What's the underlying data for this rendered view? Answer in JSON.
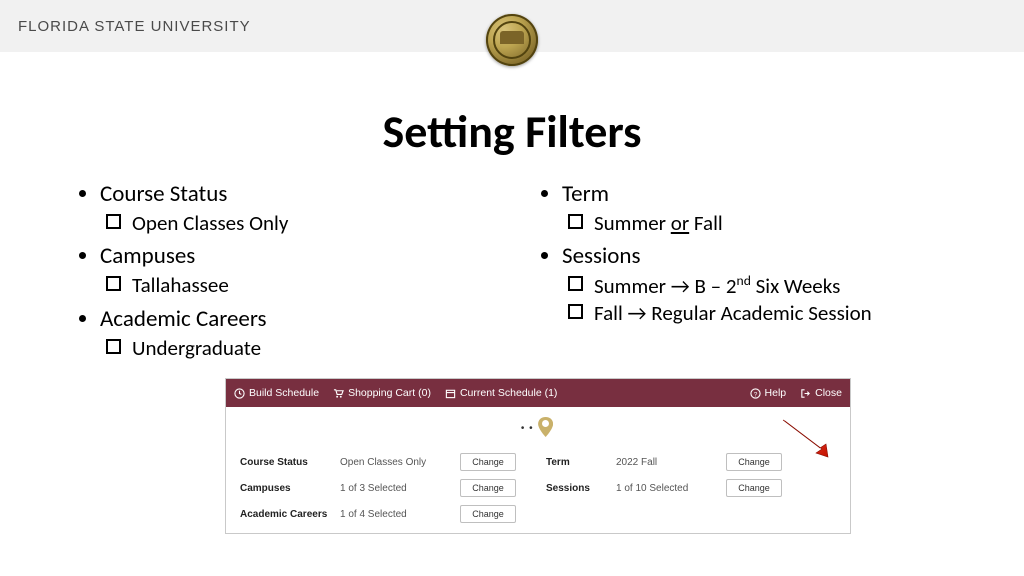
{
  "header": {
    "brand": "FLORIDA STATE UNIVERSITY"
  },
  "title": "Setting Filters",
  "left": {
    "b1": {
      "head": "Course Status",
      "sub1": "Open Classes Only"
    },
    "b2": {
      "head": "Campuses",
      "sub1": "Tallahassee"
    },
    "b3": {
      "head": "Academic Careers",
      "sub1": "Undergraduate"
    }
  },
  "right": {
    "b1": {
      "head": "Term",
      "sub_pre": "Summer ",
      "sub_or": "or",
      "sub_post": " Fall"
    },
    "b2": {
      "head": "Sessions",
      "sub1_pre": "Summer → B – 2",
      "sub1_sup": "nd",
      "sub1_post": " Six Weeks",
      "sub2": "Fall → Regular Academic Session"
    }
  },
  "app": {
    "nav": {
      "build": "Build Schedule",
      "cart": "Shopping Cart (0)",
      "current": "Current Schedule (1)",
      "help": "Help",
      "close": "Close"
    },
    "rows": {
      "r1": {
        "label": "Course Status",
        "value": "Open Classes Only"
      },
      "r2": {
        "label": "Campuses",
        "value": "1 of 3 Selected"
      },
      "r3": {
        "label": "Academic Careers",
        "value": "1 of 4 Selected"
      },
      "r4": {
        "label": "Term",
        "value": "2022 Fall"
      },
      "r5": {
        "label": "Sessions",
        "value": "1 of 10 Selected"
      }
    },
    "change": "Change"
  }
}
